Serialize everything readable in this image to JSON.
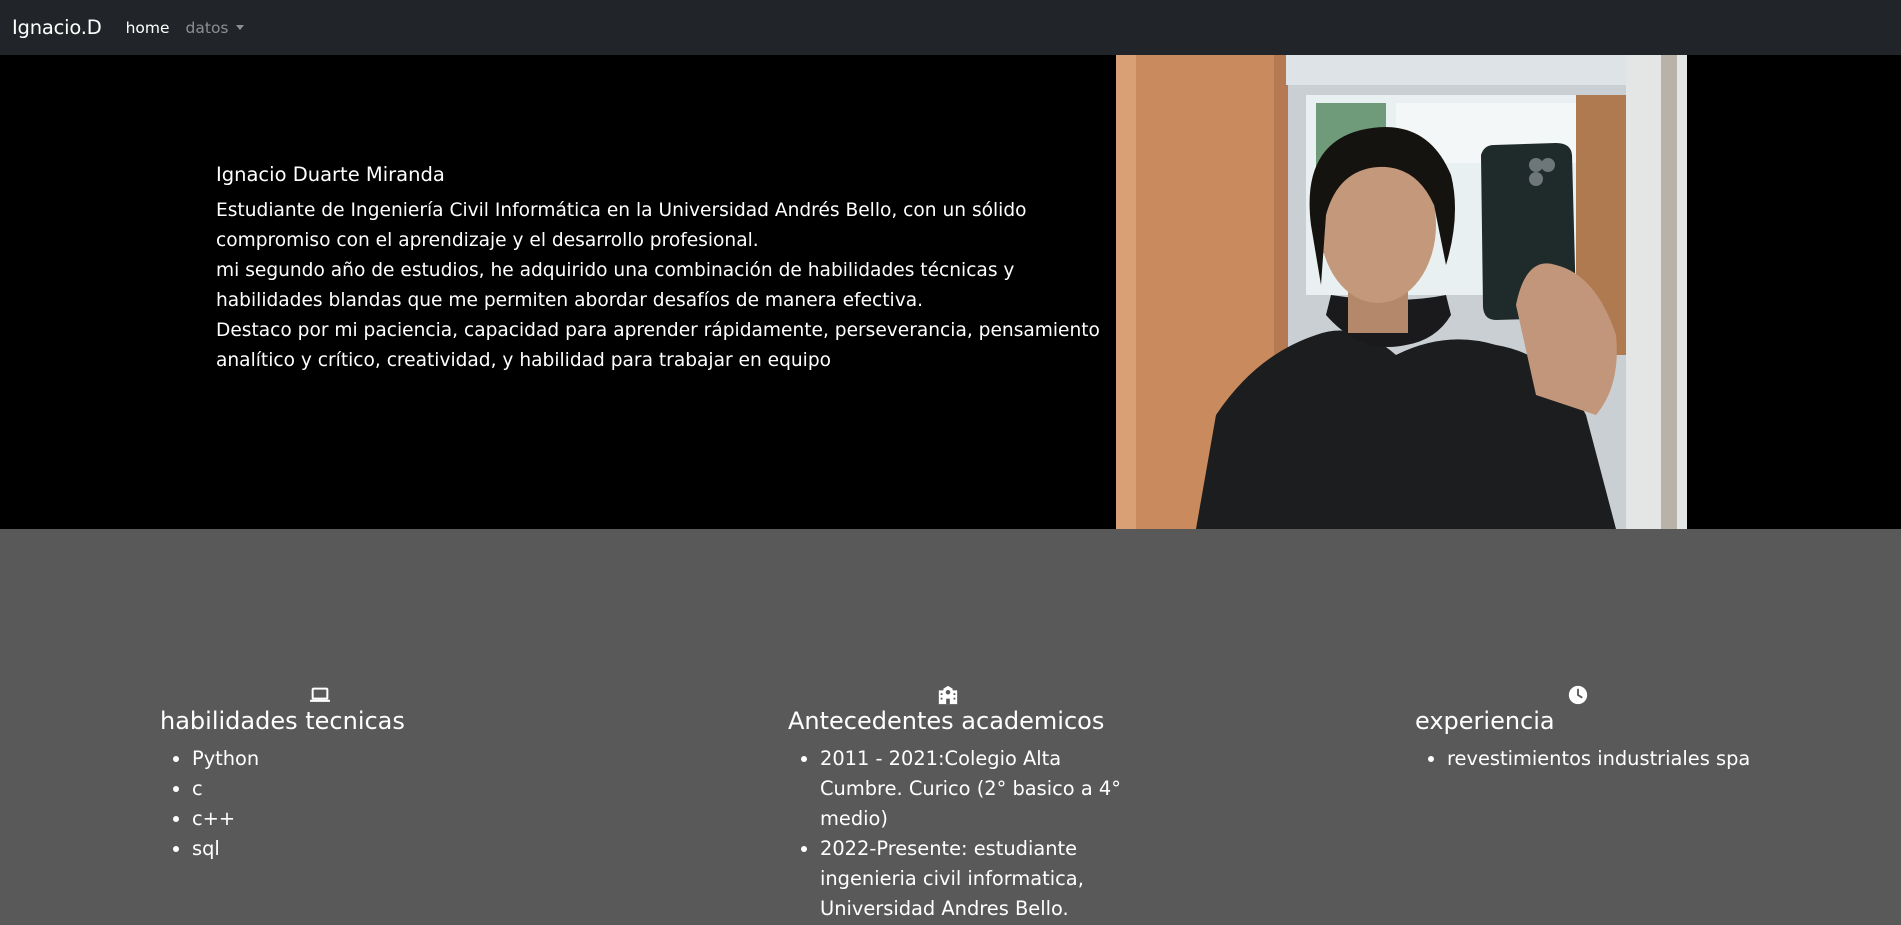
{
  "navbar": {
    "brand": "Ignacio.D",
    "home_label": "home",
    "datos_label": "datos"
  },
  "hero": {
    "name": "Ignacio Duarte Miranda",
    "paragraphs": [
      "Estudiante de Ingeniería Civil Informática en la Universidad Andrés Bello, con un sólido compromiso con el aprendizaje y el desarrollo profesional.",
      "mi segundo año de estudios, he adquirido una combinación de habilidades técnicas y habilidades blandas que me permiten abordar desafíos de manera efectiva.",
      "Destaco por mi paciencia, capacidad para aprender rápidamente, perseverancia, pensamiento analítico y crítico, creatividad, y habilidad para trabajar en equipo"
    ],
    "photo_icon": "profile-photo"
  },
  "sections": {
    "skills": {
      "icon": "laptop-icon",
      "title": "habilidades tecnicas",
      "items": [
        "Python",
        "c",
        "c++",
        "sql"
      ]
    },
    "academic": {
      "icon": "school-icon",
      "title": "Antecedentes academicos",
      "items": [
        "2011 - 2021:Colegio Alta Cumbre. Curico (2° basico a 4° medio)",
        "2022-Presente: estudiante ingenieria civil informatica, Universidad Andres Bello."
      ]
    },
    "experience": {
      "icon": "clock-icon",
      "title": "experiencia",
      "items": [
        "revestimientos industriales spa"
      ]
    }
  },
  "colors": {
    "navbar_bg": "#212529",
    "hero_bg": "#000000",
    "body_bg": "#595959"
  }
}
